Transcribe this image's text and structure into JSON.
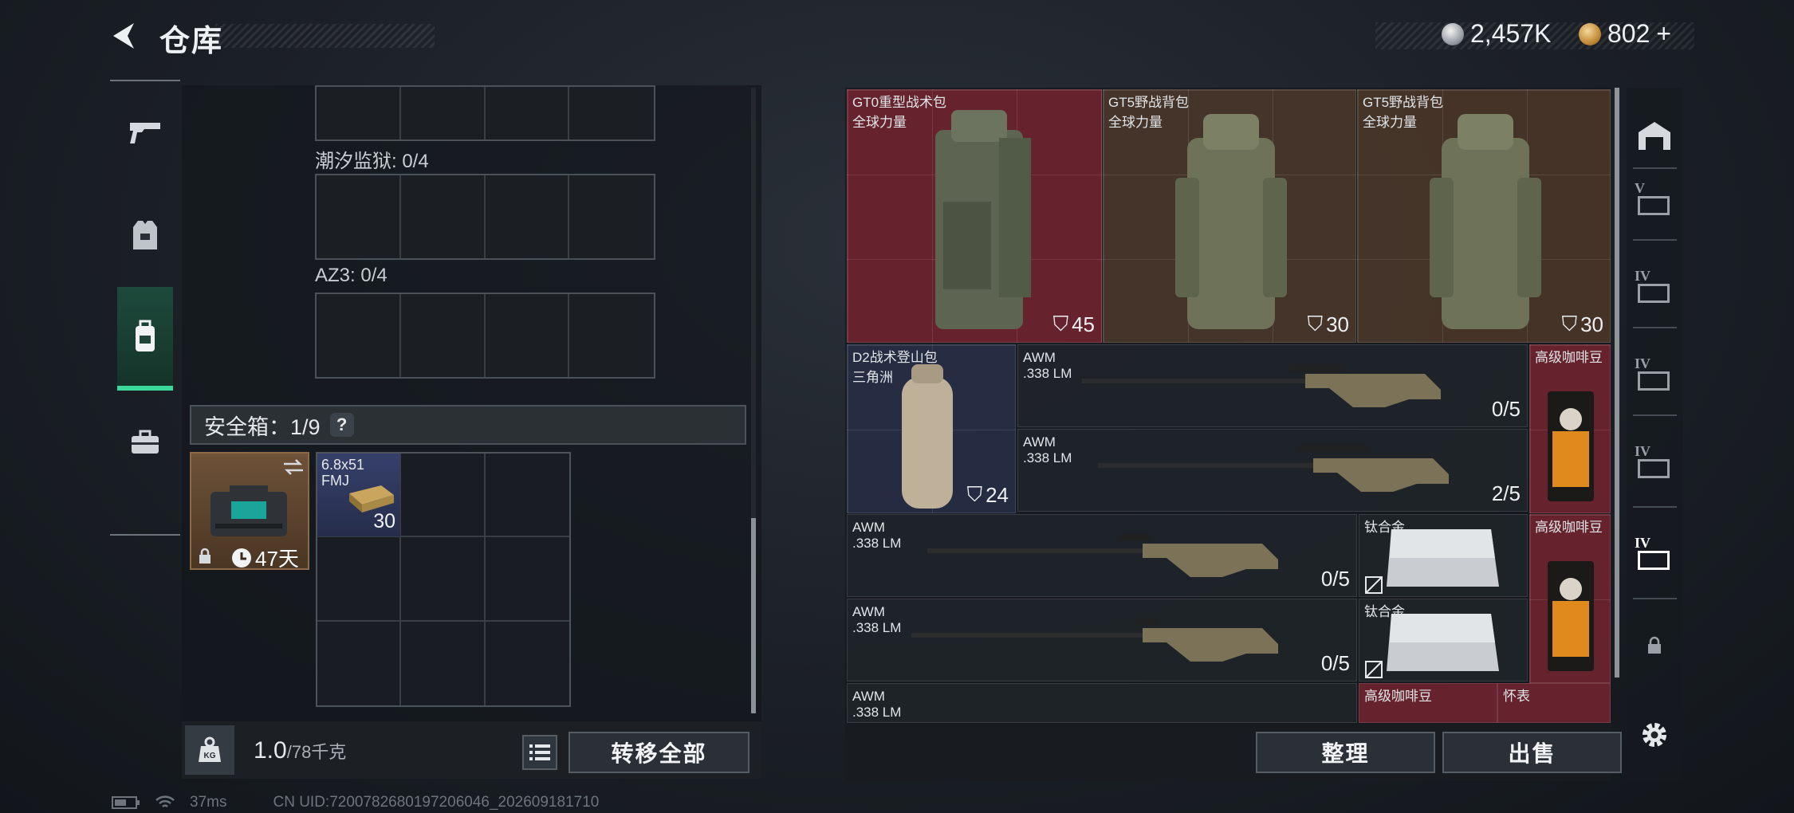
{
  "header": {
    "title": "仓库",
    "currency_silver": "2,457K",
    "currency_gold": "802",
    "gold_plus": "+"
  },
  "left_nav": {
    "items": [
      "pistol-icon",
      "armor-icon",
      "backpack-icon",
      "briefcase-icon"
    ],
    "active": "backpack-icon"
  },
  "containers": {
    "tide_prison_label": "潮汐监狱: 0/4",
    "az3_label": "AZ3: 0/4",
    "safe_box_label": "安全箱：1/9",
    "safe_help": "?",
    "safe_case_days": "47天",
    "ammo_name_line1": "6.8x51",
    "ammo_name_line2": "FMJ",
    "ammo_qty": "30"
  },
  "left_bottom": {
    "weight_value": "1.0",
    "weight_unit": "/78千克",
    "transfer_all": "转移全部"
  },
  "stash": {
    "items": [
      {
        "name": "GT0重型战术包",
        "sub": "全球力量",
        "qty": "45",
        "rarity": "red"
      },
      {
        "name": "GT5野战背包",
        "sub": "全球力量",
        "qty": "30",
        "rarity": "brown"
      },
      {
        "name": "GT5野战背包",
        "sub": "全球力量",
        "qty": "30",
        "rarity": "brown"
      },
      {
        "name": "D2战术登山包",
        "sub": "三角洲",
        "qty": "24",
        "rarity": "blue"
      },
      {
        "name": "AWM",
        "sub": ".338 LM",
        "qty": "0/5",
        "rarity": "dark"
      },
      {
        "name": "AWM",
        "sub": ".338 LM",
        "qty": "2/5",
        "rarity": "dark"
      },
      {
        "name": "高级咖啡豆",
        "sub": "",
        "qty": "",
        "rarity": "red"
      },
      {
        "name": "AWM",
        "sub": ".338 LM",
        "qty": "0/5",
        "rarity": "dark"
      },
      {
        "name": "钛合金",
        "sub": "",
        "qty": "",
        "rarity": "dark"
      },
      {
        "name": "高级咖啡豆",
        "sub": "",
        "qty": "",
        "rarity": "red"
      },
      {
        "name": "AWM",
        "sub": ".338 LM",
        "qty": "0/5",
        "rarity": "dark"
      },
      {
        "name": "钛合金",
        "sub": "",
        "qty": "",
        "rarity": "dark"
      },
      {
        "name": "AWM",
        "sub": ".338 LM",
        "qty": "",
        "rarity": "dark"
      },
      {
        "name": "高级咖啡豆",
        "sub": "",
        "qty": "",
        "rarity": "red"
      },
      {
        "name": "怀表",
        "sub": "",
        "qty": "",
        "rarity": "red"
      }
    ],
    "sort_button": "整理",
    "sell_button": "出售"
  },
  "right_nav": {
    "tiers": [
      "V",
      "IV",
      "IV",
      "IV",
      "IV"
    ]
  },
  "status_bar": {
    "ping": "37ms",
    "uid": "CN UID:7200782680197206046_202609181710"
  },
  "colors": {
    "accent_green": "#3bd99a",
    "rarity_red": "#742530",
    "rarity_brown": "#4e382a",
    "rarity_blue": "#282f46"
  }
}
